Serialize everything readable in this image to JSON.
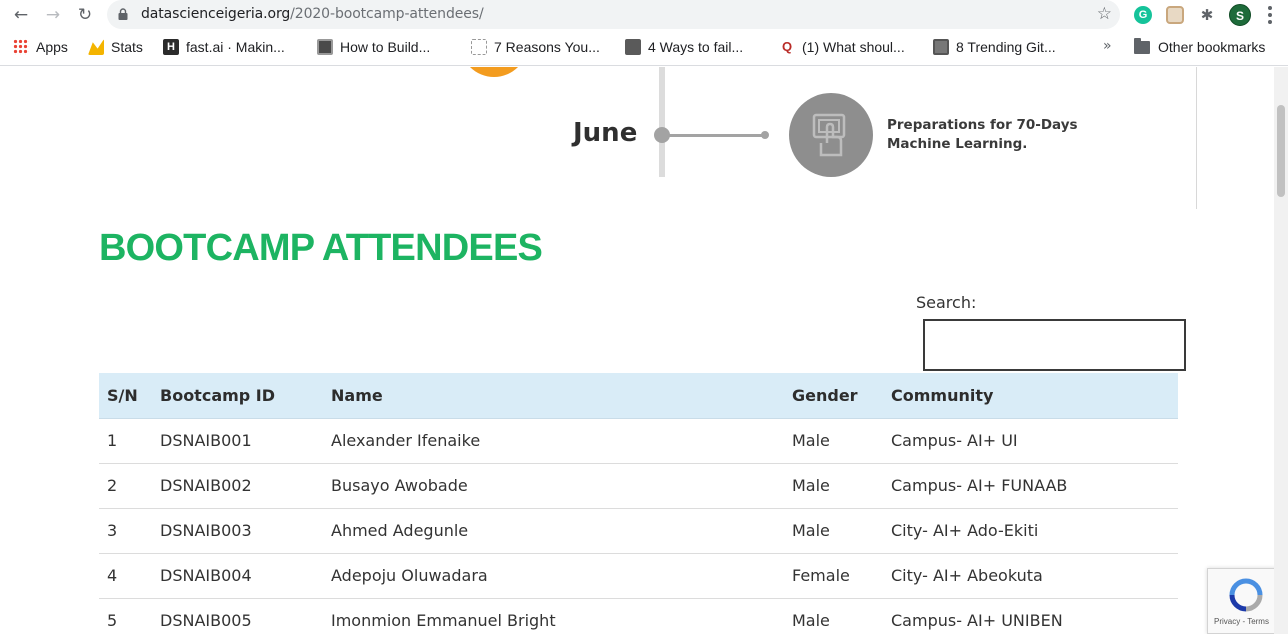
{
  "browser": {
    "url_host": "datascienceigeria.org",
    "url_path": "/2020-bootcamp-attendees/",
    "profile_initial": "S",
    "grammarly_initial": "G",
    "icons": {
      "back": "arrow-left-icon",
      "forward": "arrow-right-icon",
      "reload": "reload-icon",
      "bookmark": "star-icon",
      "menu": "more-vertical-icon"
    }
  },
  "bookmarks": {
    "items": [
      {
        "label": "Apps"
      },
      {
        "label": "Stats"
      },
      {
        "label": "fast.ai · Makin..."
      },
      {
        "label": "How to Build..."
      },
      {
        "label": "7 Reasons You..."
      },
      {
        "label": "4 Ways to fail..."
      },
      {
        "label": "(1) What shoul..."
      },
      {
        "label": "8 Trending Git..."
      }
    ],
    "overflow": "»",
    "other": "Other bookmarks"
  },
  "timeline": {
    "month": "June",
    "event": "Preparations for 70-Days Machine Learning."
  },
  "page": {
    "heading": "BOOTCAMP ATTENDEES",
    "search_label": "Search:"
  },
  "table": {
    "headers": [
      "S/N",
      "Bootcamp ID",
      "Name",
      "Gender",
      "Community"
    ],
    "rows": [
      [
        "1",
        "DSNAIB001",
        "Alexander Ifenaike",
        "Male",
        "Campus- AI+ UI"
      ],
      [
        "2",
        "DSNAIB002",
        "Busayo Awobade",
        "Male",
        "Campus- AI+ FUNAAB"
      ],
      [
        "3",
        "DSNAIB003",
        "Ahmed Adegunle",
        "Male",
        "City- AI+ Ado-Ekiti"
      ],
      [
        "4",
        "DSNAIB004",
        "Adepoju Oluwadara",
        "Female",
        "City- AI+ Abeokuta"
      ],
      [
        "5",
        "DSNAIB005",
        "Imonmion Emmanuel Bright",
        "Male",
        "Campus- AI+ UNIBEN"
      ]
    ]
  },
  "recaptcha": {
    "links": "Privacy - Terms"
  },
  "colors": {
    "heading_green": "#1db462",
    "table_header_bg": "#d9ecf7",
    "timeline_orange": "#f39c1f"
  }
}
